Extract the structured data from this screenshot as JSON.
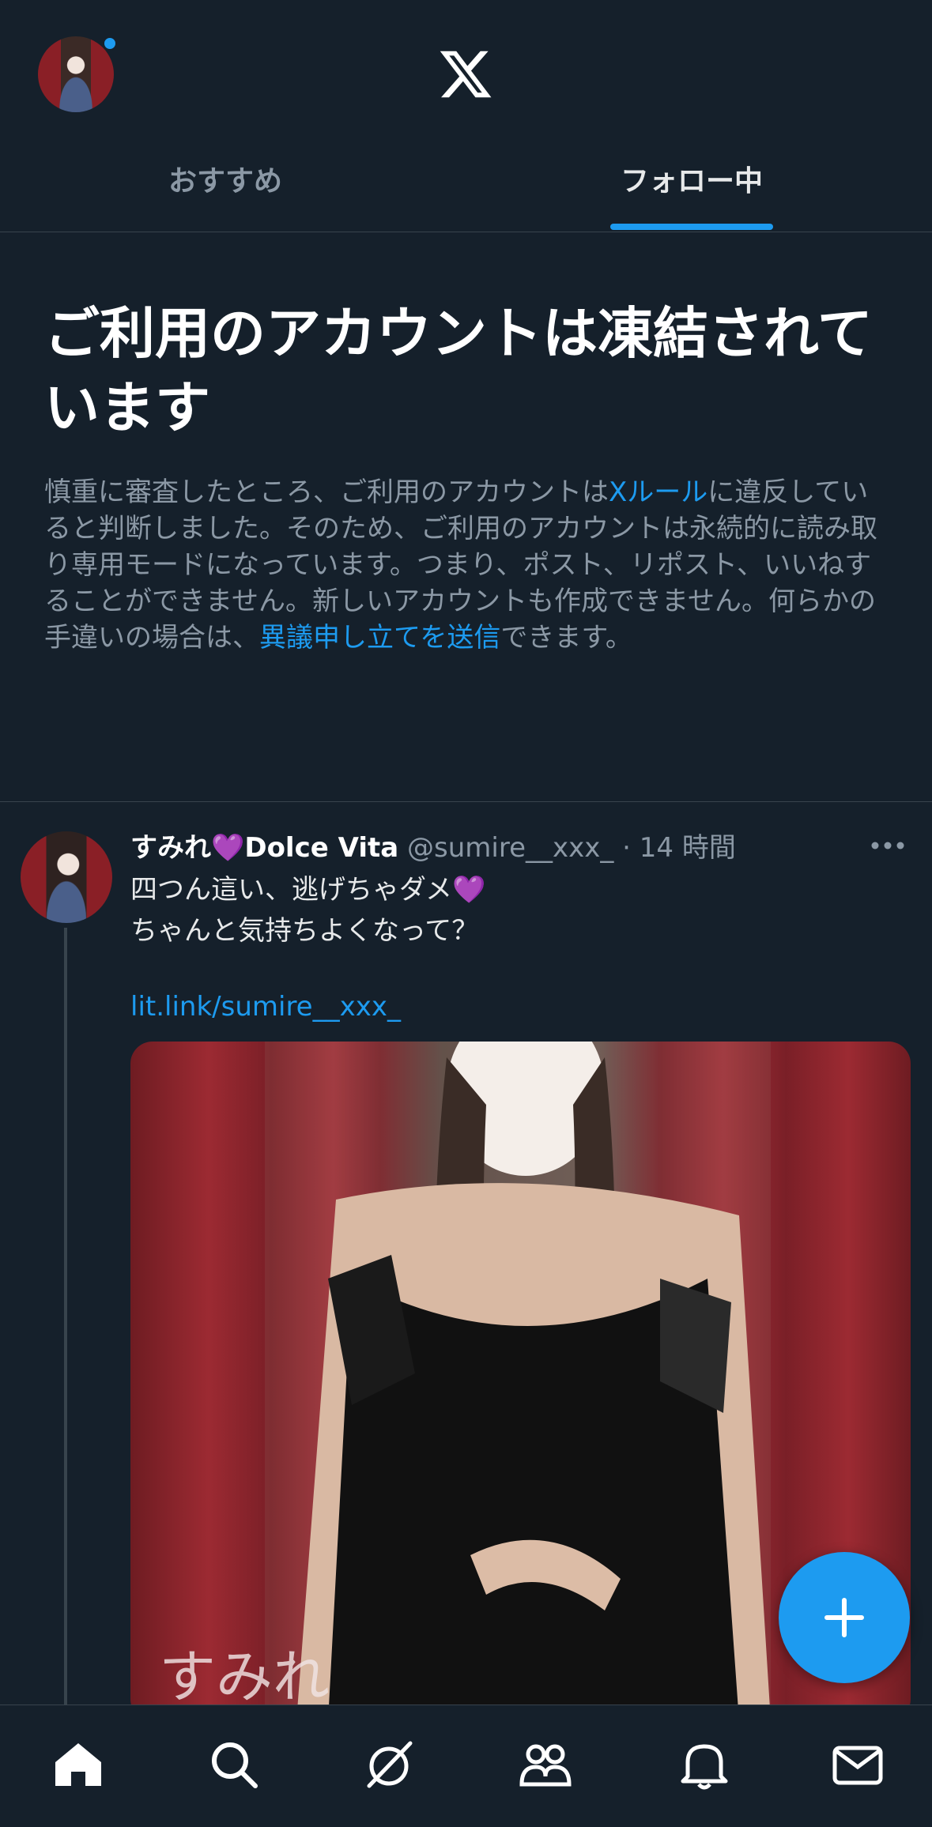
{
  "header": {
    "logo": "X",
    "tabs": [
      {
        "label": "おすすめ",
        "active": false
      },
      {
        "label": "フォロー中",
        "active": true
      }
    ],
    "notification_dot_color": "#1d9bf0"
  },
  "notice": {
    "title": "ご利用のアカウントは凍結されています",
    "body_part1": "慎重に審査したところ、ご利用のアカウントは",
    "rules_link": "Xルール",
    "body_part2": "に違反していると判断しました。そのため、ご利用のアカウントは永続的に読み取り専用モードになっています。つまり、ポスト、リポスト、いいねすることができません。新しいアカウントも作成できません。何らかの手違いの場合は、",
    "appeal_link": "異議申し立てを送信",
    "body_part3": "できます。"
  },
  "tweet": {
    "display_name_part1": "すみれ",
    "heart_emoji": "💜",
    "display_name_part2": "Dolce Vita",
    "handle": "@sumire__xxx_",
    "separator": "·",
    "time": "14 時間",
    "text_line1": "四つん這い、逃げちゃダメ",
    "text_line2": "ちゃんと気持ちよくなって？",
    "link": "lit.link/sumire__xxx_",
    "media_watermark": "すみれ"
  },
  "fab": {
    "icon": "plus-icon"
  },
  "bottom_nav": {
    "items": [
      "home-icon",
      "search-icon",
      "grok-icon",
      "communities-icon",
      "notifications-icon",
      "messages-icon"
    ]
  },
  "colors": {
    "background": "#15202b",
    "accent": "#1d9bf0",
    "secondary_text": "#8b98a5",
    "divider": "#38444d"
  }
}
